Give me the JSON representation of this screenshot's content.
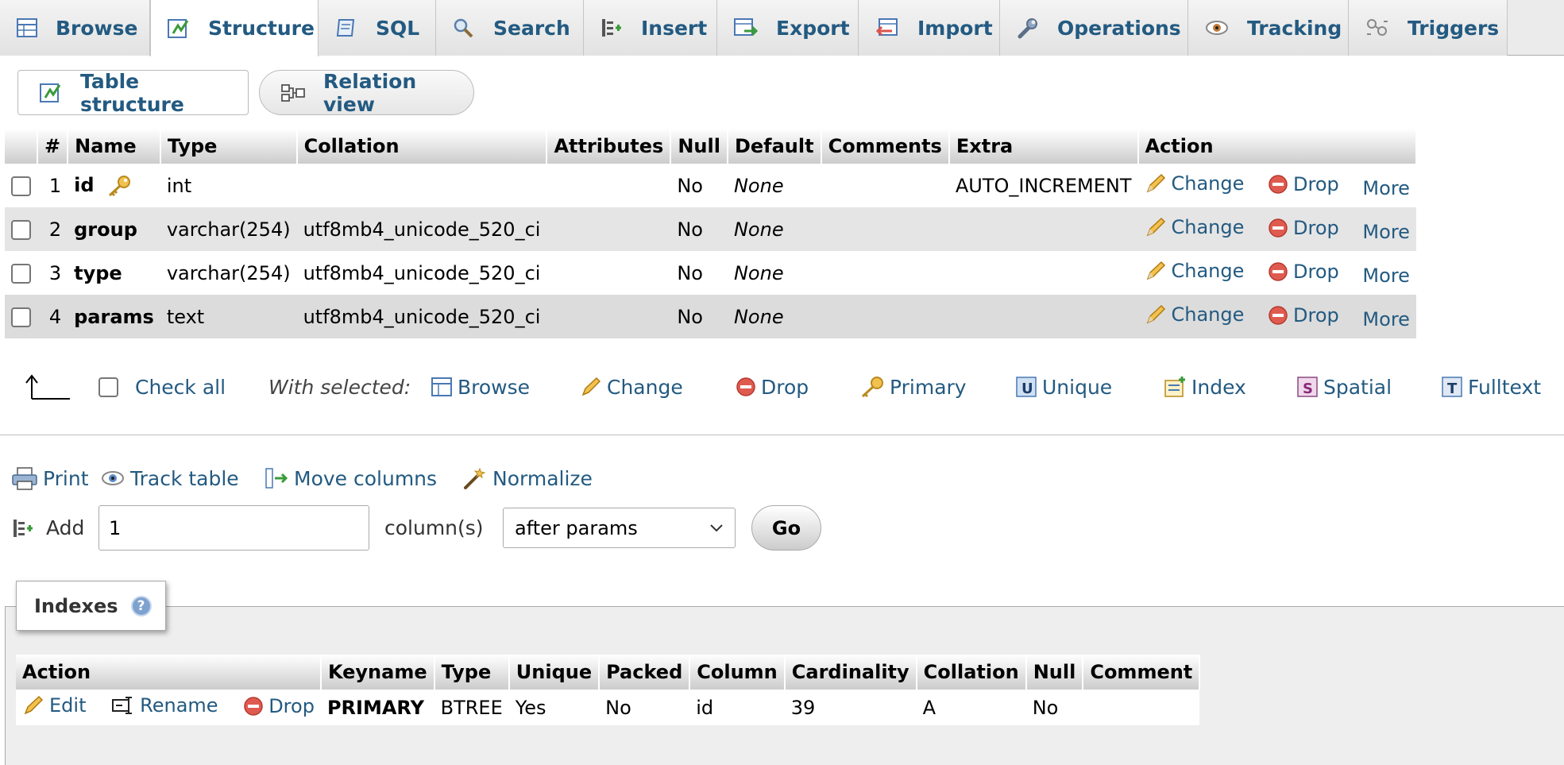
{
  "tabs": [
    {
      "label": "Browse",
      "icon": "browse-icon"
    },
    {
      "label": "Structure",
      "icon": "structure-icon",
      "active": true
    },
    {
      "label": "SQL",
      "icon": "sql-icon"
    },
    {
      "label": "Search",
      "icon": "search-icon"
    },
    {
      "label": "Insert",
      "icon": "insert-icon"
    },
    {
      "label": "Export",
      "icon": "export-icon"
    },
    {
      "label": "Import",
      "icon": "import-icon"
    },
    {
      "label": "Operations",
      "icon": "wrench-icon"
    },
    {
      "label": "Tracking",
      "icon": "eye-icon"
    },
    {
      "label": "Triggers",
      "icon": "triggers-icon"
    }
  ],
  "subnav": {
    "table_structure": "Table structure",
    "relation_view": "Relation view"
  },
  "structure": {
    "headers": [
      "",
      "#",
      "Name",
      "Type",
      "Collation",
      "Attributes",
      "Null",
      "Default",
      "Comments",
      "Extra",
      "Action"
    ],
    "rows": [
      {
        "num": "1",
        "name": "id",
        "type": "int",
        "collation": "",
        "attributes": "",
        "null": "No",
        "default": "None",
        "comments": "",
        "extra": "AUTO_INCREMENT",
        "primary_key": true
      },
      {
        "num": "2",
        "name": "group",
        "type": "varchar(254)",
        "collation": "utf8mb4_unicode_520_ci",
        "attributes": "",
        "null": "No",
        "default": "None",
        "comments": "",
        "extra": ""
      },
      {
        "num": "3",
        "name": "type",
        "type": "varchar(254)",
        "collation": "utf8mb4_unicode_520_ci",
        "attributes": "",
        "null": "No",
        "default": "None",
        "comments": "",
        "extra": ""
      },
      {
        "num": "4",
        "name": "params",
        "type": "text",
        "collation": "utf8mb4_unicode_520_ci",
        "attributes": "",
        "null": "No",
        "default": "None",
        "comments": "",
        "extra": ""
      }
    ],
    "actions": {
      "change": "Change",
      "drop": "Drop",
      "more": "More"
    }
  },
  "with_selected": {
    "check_all": "Check all",
    "label": "With selected:",
    "browse": "Browse",
    "change": "Change",
    "drop": "Drop",
    "primary": "Primary",
    "unique": "Unique",
    "index": "Index",
    "spatial": "Spatial",
    "fulltext": "Fulltext"
  },
  "bottom": {
    "print": "Print",
    "track_table": "Track table",
    "move_columns": "Move columns",
    "normalize": "Normalize"
  },
  "add": {
    "label": "Add",
    "count": "1",
    "columns_label": "column(s)",
    "position": "after params",
    "go": "Go"
  },
  "indexes": {
    "title": "Indexes",
    "help": "?",
    "headers": [
      "Action",
      "Keyname",
      "Type",
      "Unique",
      "Packed",
      "Column",
      "Cardinality",
      "Collation",
      "Null",
      "Comment"
    ],
    "actions": {
      "edit": "Edit",
      "rename": "Rename",
      "drop": "Drop"
    },
    "rows": [
      {
        "keyname": "PRIMARY",
        "type": "BTREE",
        "unique": "Yes",
        "packed": "No",
        "column": "id",
        "cardinality": "39",
        "collation": "A",
        "null": "No",
        "comment": ""
      }
    ]
  },
  "colors": {
    "link": "#235a81",
    "tab_bg": "#ebebeb",
    "row_alt": "#e5e5e5",
    "drop_red": "#d9534f",
    "pencil": "#e8a317"
  }
}
